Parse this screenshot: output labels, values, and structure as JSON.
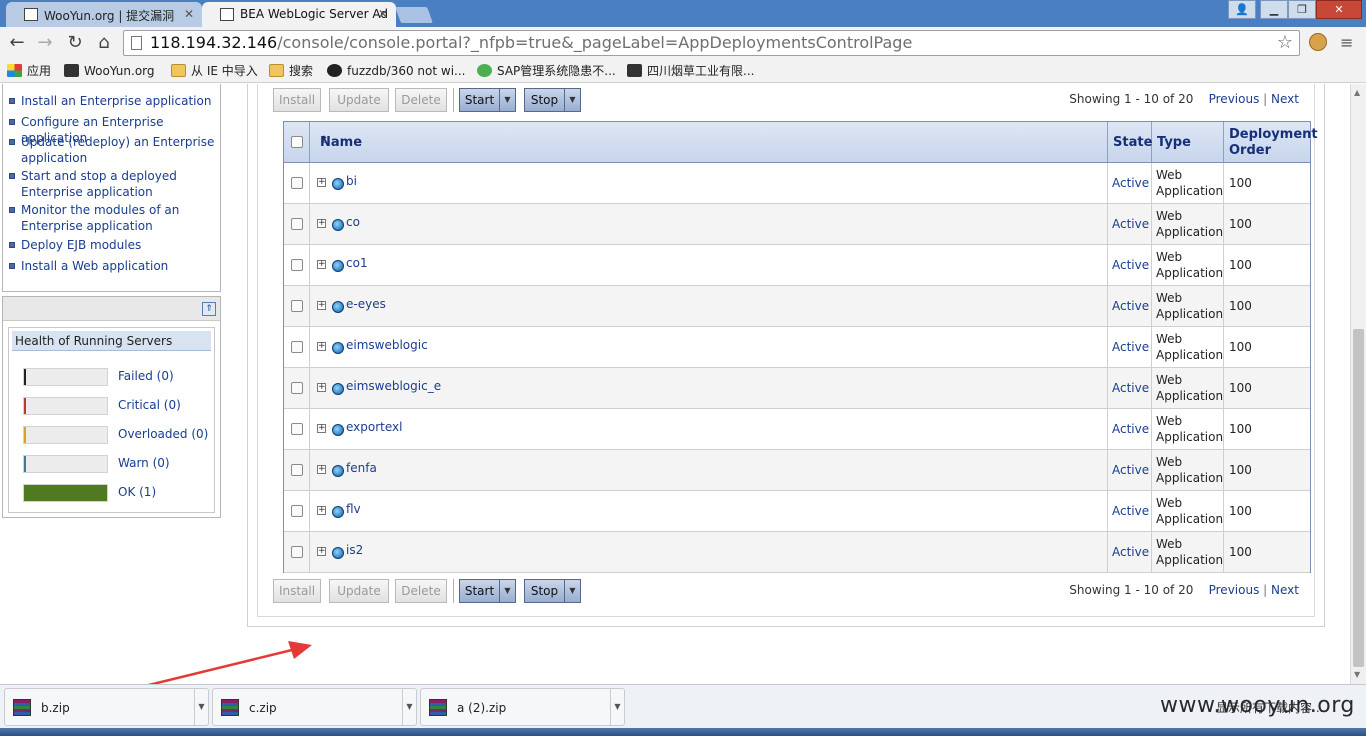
{
  "browser": {
    "tabs": [
      {
        "title": "WooYun.org | 提交漏洞"
      },
      {
        "title": "BEA WebLogic Server Ad"
      }
    ],
    "address": {
      "host": "118.194.32.146",
      "path": "/console/console.portal?_nfpb=true&_pageLabel=AppDeploymentsControlPage"
    },
    "bookmarks": [
      {
        "label": "应用",
        "icon": "apps-icon"
      },
      {
        "label": "WooYun.org",
        "icon": "wooyun-icon"
      },
      {
        "label": "从 IE 中导入",
        "icon": "folder-icon"
      },
      {
        "label": "搜索",
        "icon": "folder-icon"
      },
      {
        "label": "fuzzdb/360 not wi...",
        "icon": "github-icon"
      },
      {
        "label": "SAP管理系统隐患不...",
        "icon": "check-icon"
      },
      {
        "label": "四川烟草工业有限...",
        "icon": "wooyun-icon"
      }
    ]
  },
  "howto": {
    "items": [
      "Install an Enterprise application",
      "Configure an Enterprise application",
      "Update (redeploy) an Enterprise application",
      "Start and stop a deployed Enterprise application",
      "Monitor the modules of an Enterprise application",
      "Deploy EJB modules",
      "Install a Web application"
    ]
  },
  "health": {
    "title": "Health of Running Servers",
    "rows": [
      {
        "label": "Failed (0)",
        "color": "#222222",
        "fill": 0
      },
      {
        "label": "Critical (0)",
        "color": "#c0392b",
        "fill": 0
      },
      {
        "label": "Overloaded (0)",
        "color": "#e0a11b",
        "fill": 0
      },
      {
        "label": "Warn (0)",
        "color": "#3c7f8f",
        "fill": 0
      },
      {
        "label": "OK (1)",
        "color": "#4f7a1f",
        "fill": 1
      }
    ]
  },
  "actions": {
    "install": "Install",
    "update": "Update",
    "delete": "Delete",
    "start": "Start",
    "stop": "Stop"
  },
  "pager": {
    "showing": "Showing 1 - 10 of 20",
    "previous": "Previous",
    "separator": "|",
    "next": "Next"
  },
  "table": {
    "headers": {
      "name": "Name",
      "state": "State",
      "type": "Type",
      "order": "Deployment Order"
    },
    "rows": [
      {
        "name": "bi",
        "state": "Active",
        "type": "Web Application",
        "order": "100"
      },
      {
        "name": "co",
        "state": "Active",
        "type": "Web Application",
        "order": "100"
      },
      {
        "name": "co1",
        "state": "Active",
        "type": "Web Application",
        "order": "100"
      },
      {
        "name": "e-eyes",
        "state": "Active",
        "type": "Web Application",
        "order": "100"
      },
      {
        "name": "eimsweblogic",
        "state": "Active",
        "type": "Web Application",
        "order": "100"
      },
      {
        "name": "eimsweblogic_e",
        "state": "Active",
        "type": "Web Application",
        "order": "100"
      },
      {
        "name": "exportexl",
        "state": "Active",
        "type": "Web Application",
        "order": "100"
      },
      {
        "name": "fenfa",
        "state": "Active",
        "type": "Web Application",
        "order": "100"
      },
      {
        "name": "flv",
        "state": "Active",
        "type": "Web Application",
        "order": "100"
      },
      {
        "name": "is2",
        "state": "Active",
        "type": "Web Application",
        "order": "100"
      }
    ]
  },
  "downloads": {
    "items": [
      "b.zip",
      "c.zip",
      "a (2).zip"
    ],
    "show_all": "显示所有下载内容..."
  },
  "watermark": "www.wooyun.org",
  "colors": {
    "link": "#1a3d8f",
    "header_text": "#162f77",
    "annotation_arrow": "#e53935"
  }
}
